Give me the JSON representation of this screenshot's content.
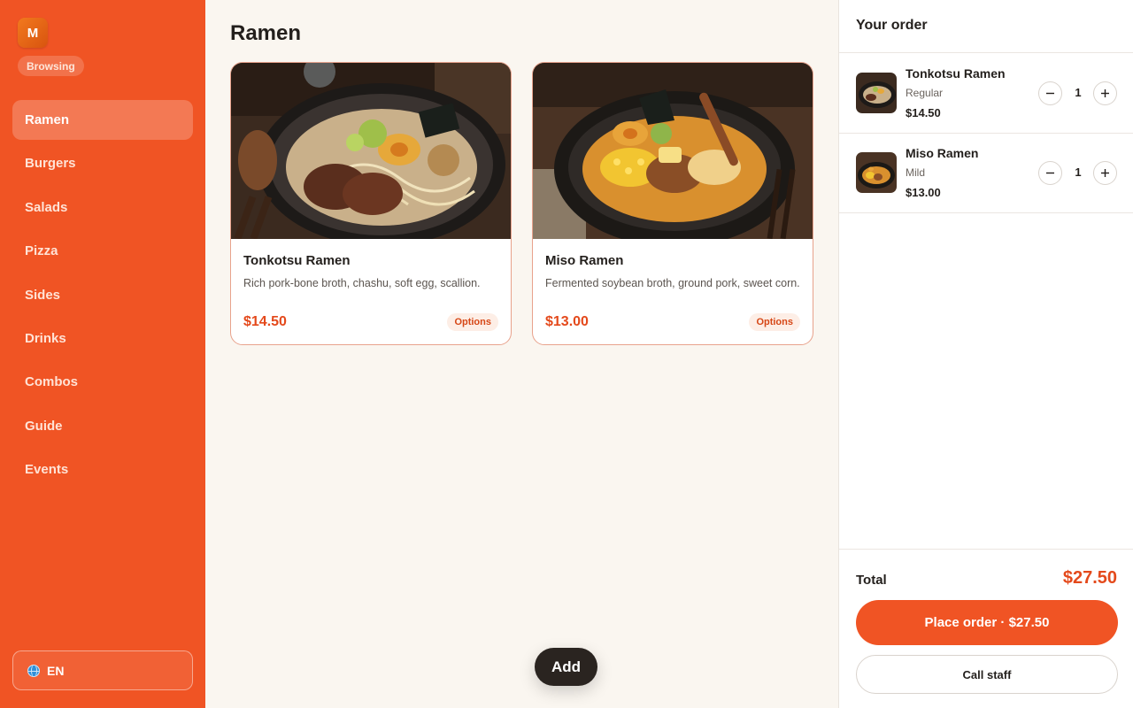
{
  "app": {
    "logo_letter": "M",
    "status": "Browsing"
  },
  "sidebar": {
    "items": [
      {
        "label": "Ramen",
        "active": true
      },
      {
        "label": "Burgers"
      },
      {
        "label": "Salads"
      },
      {
        "label": "Pizza"
      },
      {
        "label": "Sides"
      },
      {
        "label": "Drinks"
      },
      {
        "label": "Combos"
      },
      {
        "label": "Guide"
      },
      {
        "label": "Events"
      }
    ],
    "language": {
      "label": "EN",
      "icon": "globe-icon"
    }
  },
  "main": {
    "title": "Ramen",
    "cards": [
      {
        "name": "Tonkotsu Ramen",
        "description": "Rich pork-bone broth, chashu, soft egg, scallion.",
        "price": "$14.50",
        "options_label": "Options"
      },
      {
        "name": "Miso Ramen",
        "description": "Fermented soybean broth, ground pork, sweet corn.",
        "price": "$13.00",
        "options_label": "Options"
      }
    ],
    "add_label": "Add"
  },
  "order": {
    "title": "Your order",
    "items": [
      {
        "name": "Tonkotsu Ramen",
        "variant": "Regular",
        "price": "$14.50",
        "qty": "1"
      },
      {
        "name": "Miso Ramen",
        "variant": "Mild",
        "price": "$13.00",
        "qty": "1"
      }
    ],
    "total_label": "Total",
    "total_value": "$27.50",
    "place_order_label": "Place order · $27.50",
    "call_staff_label": "Call staff"
  },
  "colors": {
    "accent": "#f05424",
    "price": "#e4491b",
    "dark": "#2a2420",
    "background": "#faf6f0"
  }
}
